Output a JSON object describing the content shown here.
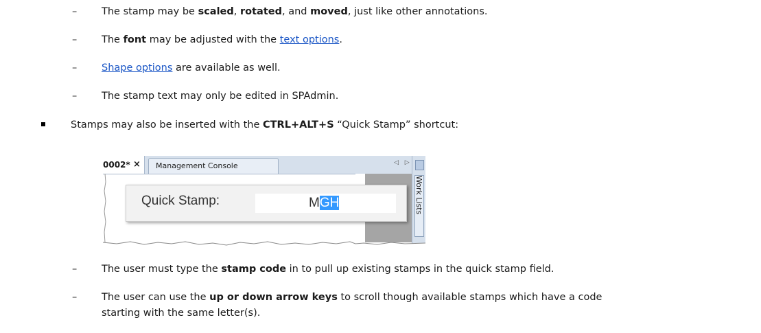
{
  "items": [
    {
      "pre": "The stamp may be ",
      "b1": "scaled",
      "m1": ", ",
      "b2": "rotated",
      "m2": ", and ",
      "b3": "moved",
      "post": ", just like other annotations."
    },
    {
      "pre": "The ",
      "b1": "font",
      "m1": " may be adjusted with the ",
      "link": "text options",
      "post": "."
    },
    {
      "link": "Shape options",
      "post": " are available as well."
    },
    {
      "text": "The stamp text may only be edited in SPAdmin."
    }
  ],
  "main_bullet": {
    "pre": "Stamps may also be inserted with the ",
    "bold": "CTRL+ALT+S",
    "post": " “Quick Stamp” shortcut:"
  },
  "screenshot": {
    "active_tab": "0002*",
    "close_glyph": "×",
    "other_tab": "Management Console",
    "nav_arrows": "◁ ▷",
    "side_label": "Work Lists",
    "popup_label": "Quick Stamp:",
    "input_plain": "M",
    "input_selected": "GH"
  },
  "sub_items": [
    {
      "pre": "The user must type the ",
      "bold": "stamp code",
      "post": " in to pull up existing stamps in the quick stamp field."
    },
    {
      "pre": "The user can use the ",
      "bold": "up or down arrow keys",
      "post": " to scroll though available stamps which have a code",
      "cont": "starting with the same letter(s)."
    }
  ],
  "dash_glyph": "–"
}
